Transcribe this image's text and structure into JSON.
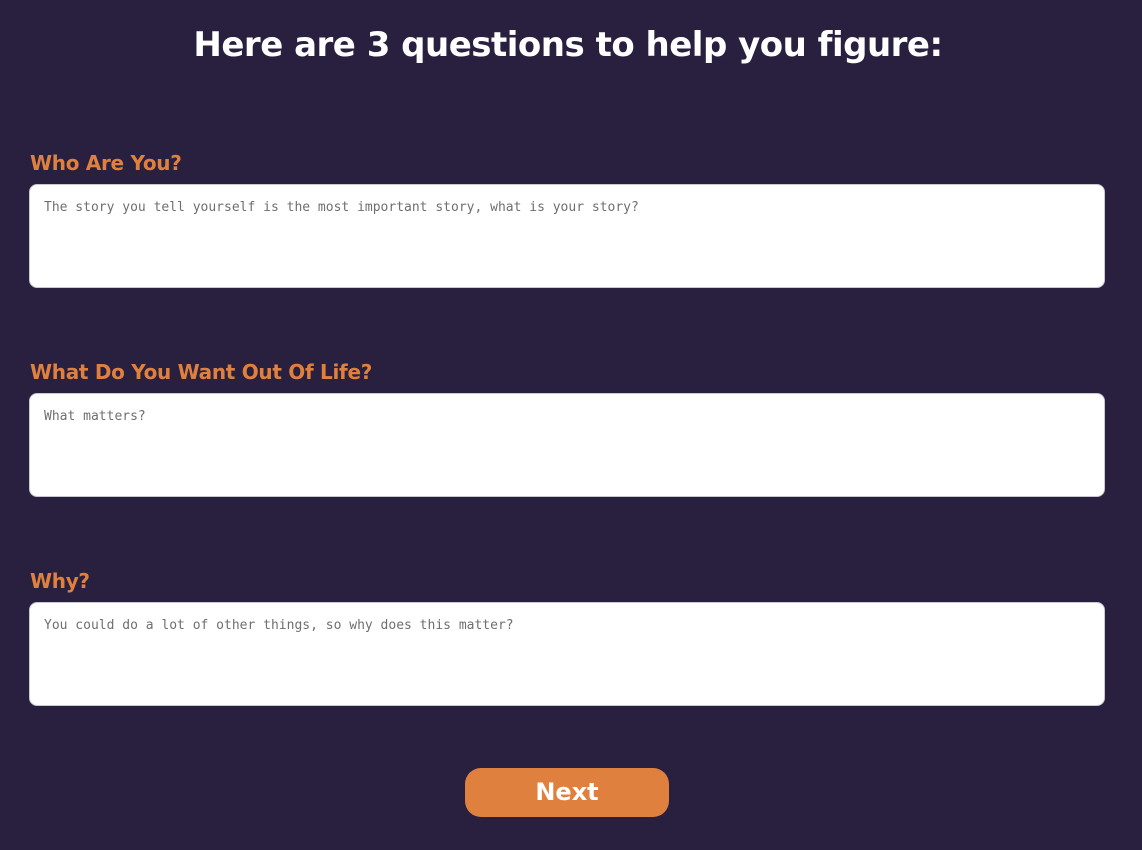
{
  "header": {
    "title": "Here are 3 questions to help you figure:"
  },
  "questions": [
    {
      "label": "Who Are You?",
      "placeholder": "The story you tell yourself is the most important story, what is your story?",
      "value": ""
    },
    {
      "label": "What Do You Want Out Of Life?",
      "placeholder": "What matters?",
      "value": ""
    },
    {
      "label": "Why?",
      "placeholder": "You could do a lot of other things, so why does this matter?",
      "value": ""
    }
  ],
  "actions": {
    "next_label": "Next"
  },
  "colors": {
    "background": "#29203f",
    "accent": "#e0803f",
    "title": "#ffffff",
    "input_background": "#ffffff"
  }
}
